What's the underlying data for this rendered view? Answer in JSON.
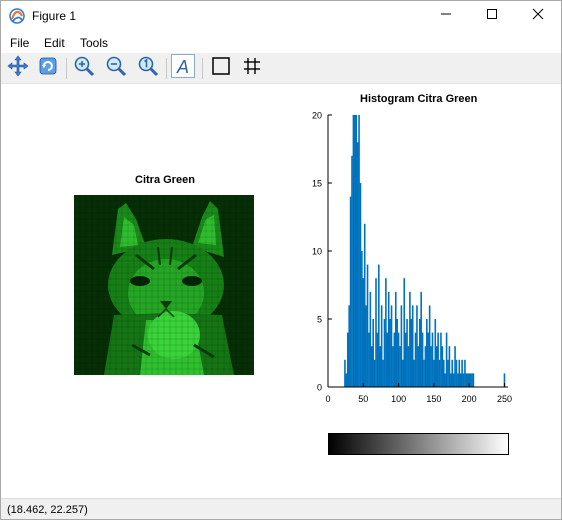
{
  "window": {
    "title": "Figure 1",
    "controls": {
      "minimize": "minimize",
      "maximize": "maximize",
      "close": "close"
    }
  },
  "menu": {
    "items": [
      "File",
      "Edit",
      "Tools"
    ]
  },
  "toolbar": {
    "tools": [
      "pan-icon",
      "rotate-icon",
      "zoom-in-icon",
      "zoom-out-icon",
      "zoom-reset-icon",
      "text-insert-icon",
      "box-toggle-icon",
      "grid-toggle-icon"
    ]
  },
  "image_plot": {
    "title": "Citra Green"
  },
  "histogram_plot": {
    "title": "Histogram Citra Green"
  },
  "chart_data": {
    "type": "bar",
    "title": "Histogram Citra Green",
    "xlabel": "",
    "ylabel": "",
    "xlim": [
      0,
      255
    ],
    "ylim": [
      0,
      20
    ],
    "xticks": [
      0,
      50,
      100,
      150,
      200,
      250
    ],
    "yticks": [
      0,
      5,
      10,
      15,
      20
    ],
    "grid": false,
    "bar_color": "#0072bd",
    "x": [
      24,
      26,
      28,
      30,
      32,
      34,
      36,
      38,
      40,
      42,
      44,
      46,
      48,
      50,
      52,
      54,
      56,
      58,
      60,
      62,
      64,
      66,
      68,
      70,
      72,
      74,
      76,
      78,
      80,
      82,
      84,
      86,
      88,
      90,
      92,
      94,
      96,
      98,
      100,
      102,
      104,
      106,
      108,
      110,
      112,
      114,
      116,
      118,
      120,
      122,
      124,
      126,
      128,
      130,
      132,
      134,
      136,
      138,
      140,
      142,
      144,
      146,
      148,
      150,
      152,
      154,
      156,
      158,
      160,
      162,
      164,
      166,
      168,
      170,
      172,
      174,
      176,
      178,
      180,
      182,
      184,
      186,
      188,
      190,
      192,
      194,
      196,
      198,
      200,
      202,
      204,
      206,
      250
    ],
    "values": [
      2,
      1,
      4,
      6,
      14,
      17,
      20,
      20,
      20,
      18,
      20,
      15,
      10,
      8,
      12,
      6,
      9,
      4,
      7,
      3,
      5,
      2,
      8,
      4,
      9,
      3,
      6,
      2,
      5,
      8,
      4,
      7,
      5,
      6,
      3,
      4,
      7,
      5,
      4,
      3,
      6,
      2,
      8,
      4,
      5,
      3,
      7,
      5,
      6,
      2,
      4,
      6,
      3,
      5,
      7,
      4,
      2,
      3,
      5,
      4,
      6,
      3,
      4,
      2,
      5,
      3,
      4,
      2,
      4,
      3,
      2,
      1,
      4,
      2,
      3,
      1,
      2,
      1,
      3,
      2,
      1,
      2,
      1,
      2,
      1,
      2,
      1,
      1,
      1,
      1,
      1,
      1,
      1
    ]
  },
  "colorbar": {
    "colormap": "gray",
    "range": [
      0,
      255
    ]
  },
  "status": {
    "coords": "(18.462, 22.257)"
  }
}
